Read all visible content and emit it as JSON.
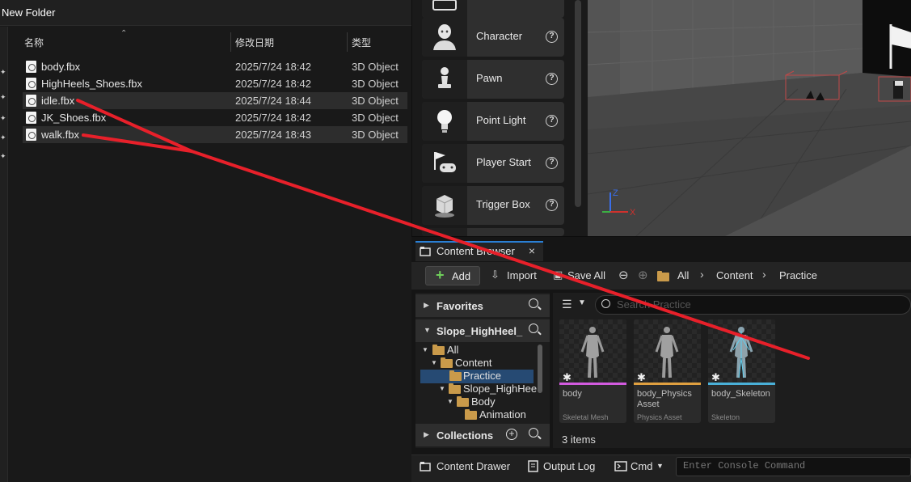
{
  "explorer": {
    "title": "New Folder",
    "columns": {
      "name": "名称",
      "date": "修改日期",
      "type": "类型"
    },
    "files": [
      {
        "name": "body.fbx",
        "date": "2025/7/24 18:42",
        "type": "3D Object",
        "selected": false
      },
      {
        "name": "HighHeels_Shoes.fbx",
        "date": "2025/7/24 18:42",
        "type": "3D Object",
        "selected": false
      },
      {
        "name": "idle.fbx",
        "date": "2025/7/24 18:44",
        "type": "3D Object",
        "selected": true
      },
      {
        "name": "JK_Shoes.fbx",
        "date": "2025/7/24 18:42",
        "type": "3D Object",
        "selected": false
      },
      {
        "name": "walk.fbx",
        "date": "2025/7/24 18:43",
        "type": "3D Object",
        "selected": true
      }
    ]
  },
  "place_actors": {
    "items": [
      {
        "label": "Character",
        "icon": "character-icon"
      },
      {
        "label": "Pawn",
        "icon": "pawn-icon"
      },
      {
        "label": "Point Light",
        "icon": "lightbulb-icon"
      },
      {
        "label": "Player Start",
        "icon": "player-start-icon"
      },
      {
        "label": "Trigger Box",
        "icon": "trigger-box-icon"
      }
    ]
  },
  "viewport": {
    "axis_z": "Z",
    "axis_x": "X",
    "colors": {
      "x": "#d0312d",
      "y": "#3cb043",
      "z": "#3a6ee8"
    }
  },
  "content_browser": {
    "tab_label": "Content Browser",
    "toolbar": {
      "add": "Add",
      "import": "Import",
      "save_all": "Save All",
      "breadcrumbs": [
        "All",
        "Content",
        "Practice"
      ]
    },
    "sources": {
      "favorites": "Favorites",
      "project": "Slope_HighHeel_",
      "collections": "Collections",
      "tree": [
        {
          "label": "All",
          "level": 0
        },
        {
          "label": "Content",
          "level": 1
        },
        {
          "label": "Practice",
          "level": 2,
          "selected": true
        },
        {
          "label": "Slope_HighHee",
          "level": 2
        },
        {
          "label": "Body",
          "level": 3
        },
        {
          "label": "Animation",
          "level": 4
        }
      ]
    },
    "search_placeholder": "Search Practice",
    "assets": [
      {
        "name": "body",
        "type": "Skeletal Mesh",
        "color": "#d35be0"
      },
      {
        "name": "body_Physics Asset",
        "type": "Physics Asset",
        "color": "#e0a040"
      },
      {
        "name": "body_Skeleton",
        "type": "Skeleton",
        "color": "#4ab0d8"
      }
    ],
    "item_count": "3 items"
  },
  "statusbar": {
    "content_drawer": "Content Drawer",
    "output_log": "Output Log",
    "cmd": "Cmd",
    "console_placeholder": "Enter Console Command"
  },
  "annotation_color": "#e8202a"
}
